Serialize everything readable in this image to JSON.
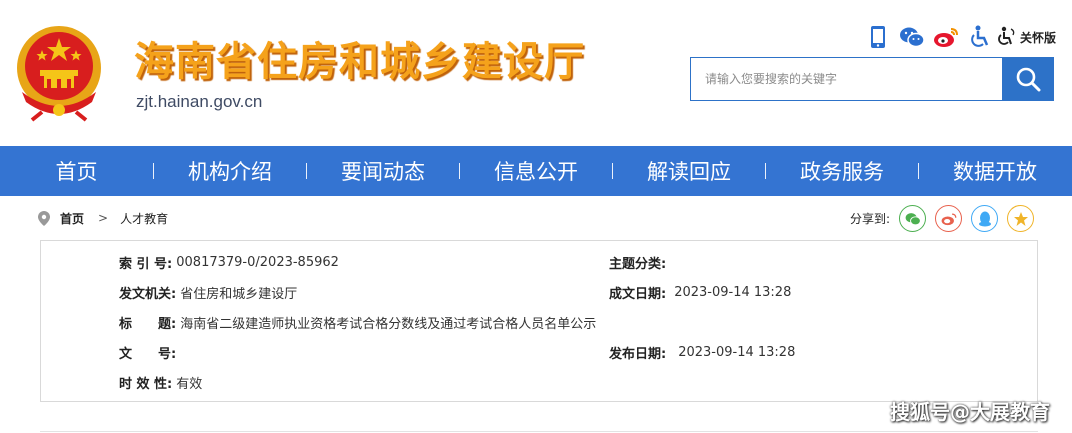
{
  "header": {
    "site_title": "海南省住房和城乡建设厅",
    "site_domain": "zjt.hainan.gov.cn",
    "care_mode_label": "关怀版",
    "icons": [
      "mobile-icon",
      "wechat-icon",
      "weibo-icon",
      "accessibility-icon",
      "care-mode-icon"
    ],
    "search_placeholder": "请输入您要搜索的关键字"
  },
  "nav": {
    "items": [
      "首页",
      "机构介绍",
      "要闻动态",
      "信息公开",
      "解读回应",
      "政务服务",
      "数据开放"
    ]
  },
  "breadcrumb": {
    "home": "首页",
    "current": "人才教育"
  },
  "share": {
    "label": "分享到:",
    "targets": [
      "wechat",
      "weibo",
      "qq",
      "qzone"
    ]
  },
  "info": {
    "index_no_label": "索 引 号:",
    "index_no": "00817379-0/2023-85962",
    "category_label": "主题分类:",
    "category": "",
    "issuer_label": "发文机关:",
    "issuer": "省住房和城乡建设厅",
    "created_label": "成文日期:",
    "created": "2023-09-14 13:28",
    "title_label": "标　　题:",
    "title": "海南省二级建造师执业资格考试合格分数线及通过考试合格人员名单公示",
    "doc_no_label": "文　　号:",
    "doc_no": "",
    "published_label": "发布日期:",
    "published": "2023-09-14 13:28",
    "validity_label": "时 效 性:",
    "validity": "有效"
  },
  "watermark": "搜狐号@大展教育",
  "colors": {
    "nav_bg": "#3474d2",
    "title_orange": "#f5a21b",
    "search_blue": "#2d72c8"
  }
}
